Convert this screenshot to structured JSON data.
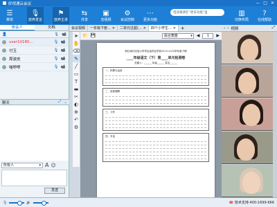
{
  "window": {
    "title": "好视通云会议",
    "controls": [
      "—",
      "□",
      "✕"
    ]
  },
  "toolbar": {
    "left_buttons": [
      {
        "label": "菜单",
        "icon": "menu-icon"
      },
      {
        "label": "放弃发言",
        "icon": "mic-icon"
      },
      {
        "label": "放弃主讲",
        "icon": "presenter-icon"
      },
      {
        "label": "共享",
        "icon": "share-icon"
      },
      {
        "label": "音视频",
        "icon": "camera-icon"
      },
      {
        "label": "会议控制",
        "icon": "meeting-control-icon"
      },
      {
        "label": "更多功能",
        "icon": "more-icon"
      }
    ],
    "notice": "电话邀请在“更多功能”里",
    "right_buttons": [
      {
        "label": "切换布局",
        "icon": "layout-icon"
      },
      {
        "label": "在线帮助",
        "icon": "help-icon"
      }
    ]
  },
  "left_panel": {
    "tabs": [
      "参会人",
      "文档"
    ],
    "header_icons": [
      "user-icon",
      "mic-icon",
      "camera-icon"
    ],
    "users": [
      {
        "name": "user10180...",
        "is_me": true
      },
      {
        "name": "付玉",
        "is_me": false
      },
      {
        "name": "周波皮",
        "is_me": false
      },
      {
        "name": "喵咿咿",
        "is_me": false
      }
    ]
  },
  "chat": {
    "title": "聊天",
    "recipient": "所有人",
    "send_label": "发送"
  },
  "doc_tabs": [
    "会议视频",
    "一年级下册...",
    "二单元过超(...",
    "四个小学生..."
  ],
  "doc_bar": {
    "zoom": "适合宽度",
    "page": "1"
  },
  "paper": {
    "school_line": "新红南外实验小学学区高项目学校2019-2020学年度下期",
    "title": "____年级语文（下）第____单元检测卷",
    "info": "总题入：______  年级______  姓名______",
    "sections": [
      "一、积累与运用",
      "二、阅读理解",
      "三、习作",
      "四、写话"
    ]
  },
  "video_panel": {
    "label": "视频"
  },
  "status": {
    "support": "技术支持:400-1699-666"
  }
}
